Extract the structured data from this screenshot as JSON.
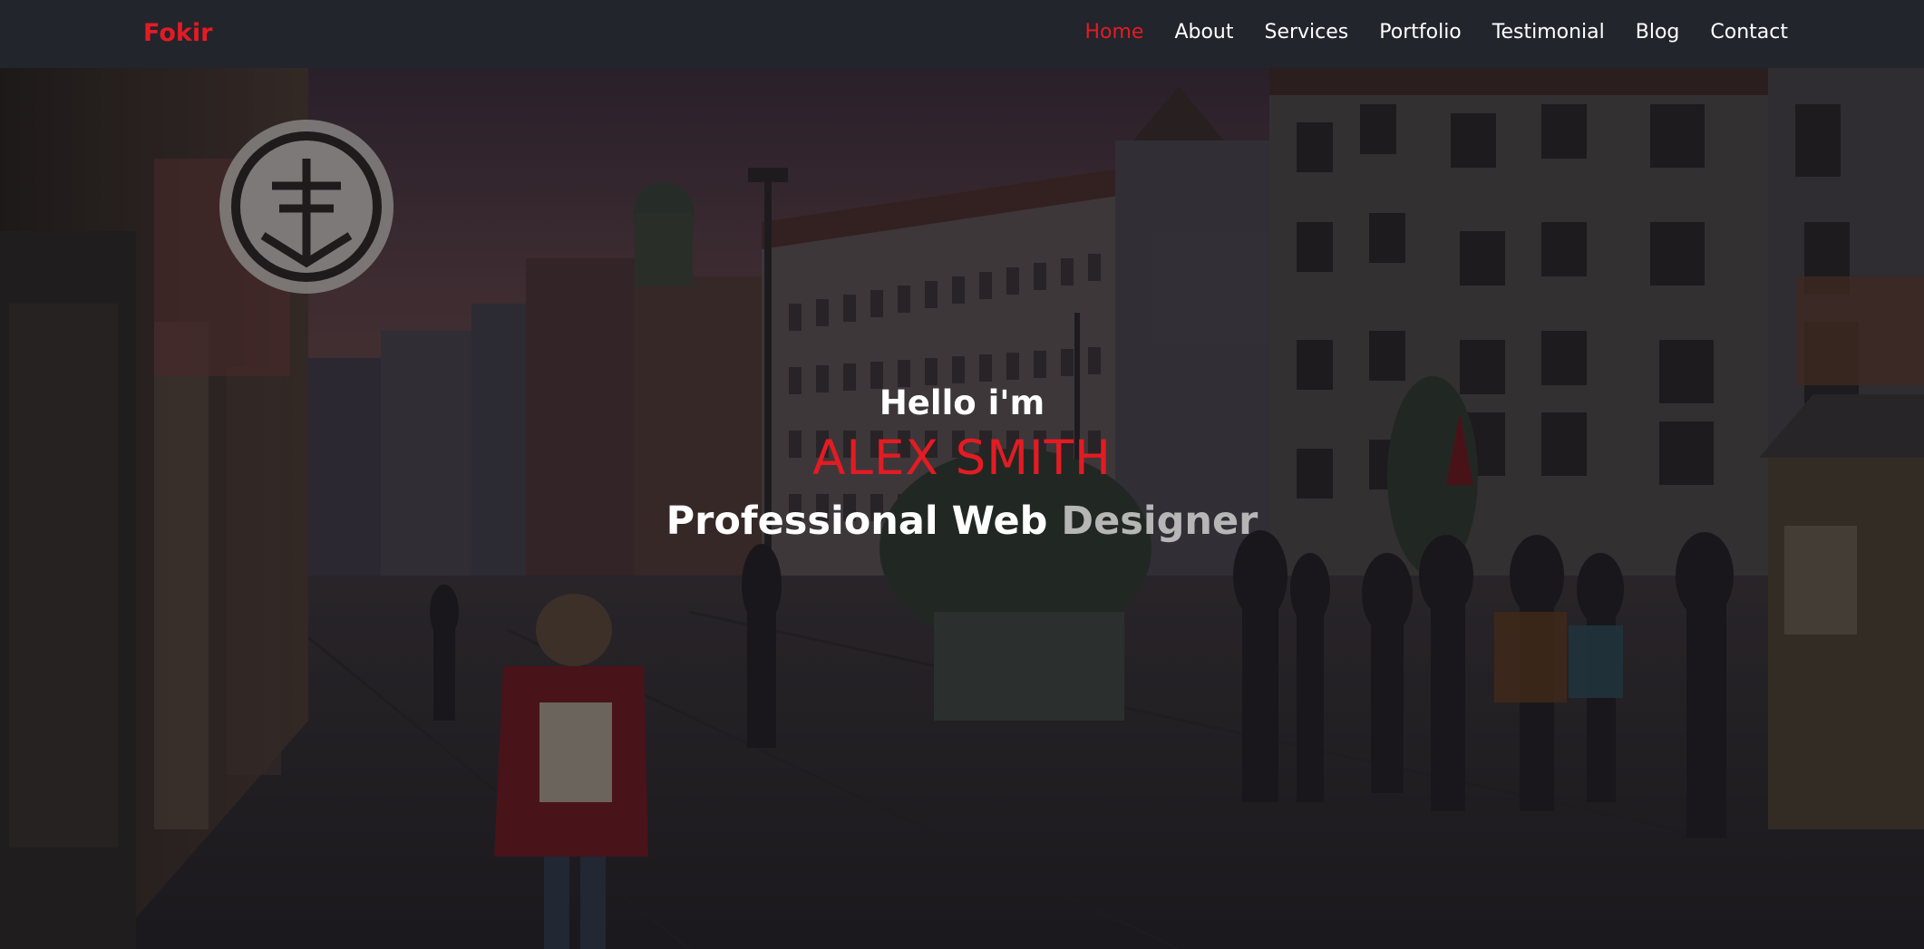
{
  "brand": "Fokir",
  "nav": {
    "items": [
      {
        "label": "Home",
        "active": true
      },
      {
        "label": "About",
        "active": false
      },
      {
        "label": "Services",
        "active": false
      },
      {
        "label": "Portfolio",
        "active": false
      },
      {
        "label": "Testimonial",
        "active": false
      },
      {
        "label": "Blog",
        "active": false
      },
      {
        "label": "Contact",
        "active": false
      }
    ]
  },
  "hero": {
    "greeting": "Hello i'm",
    "name": "ALEX SMITH",
    "tagline_static": "Professional Web ",
    "tagline_typed": "Designer",
    "background_description_icon": "city-street-photo"
  },
  "colors": {
    "accent": "#e41b23",
    "navbar_bg": "#22252c",
    "text": "#ffffff",
    "typed_text": "#b6b6b6"
  }
}
